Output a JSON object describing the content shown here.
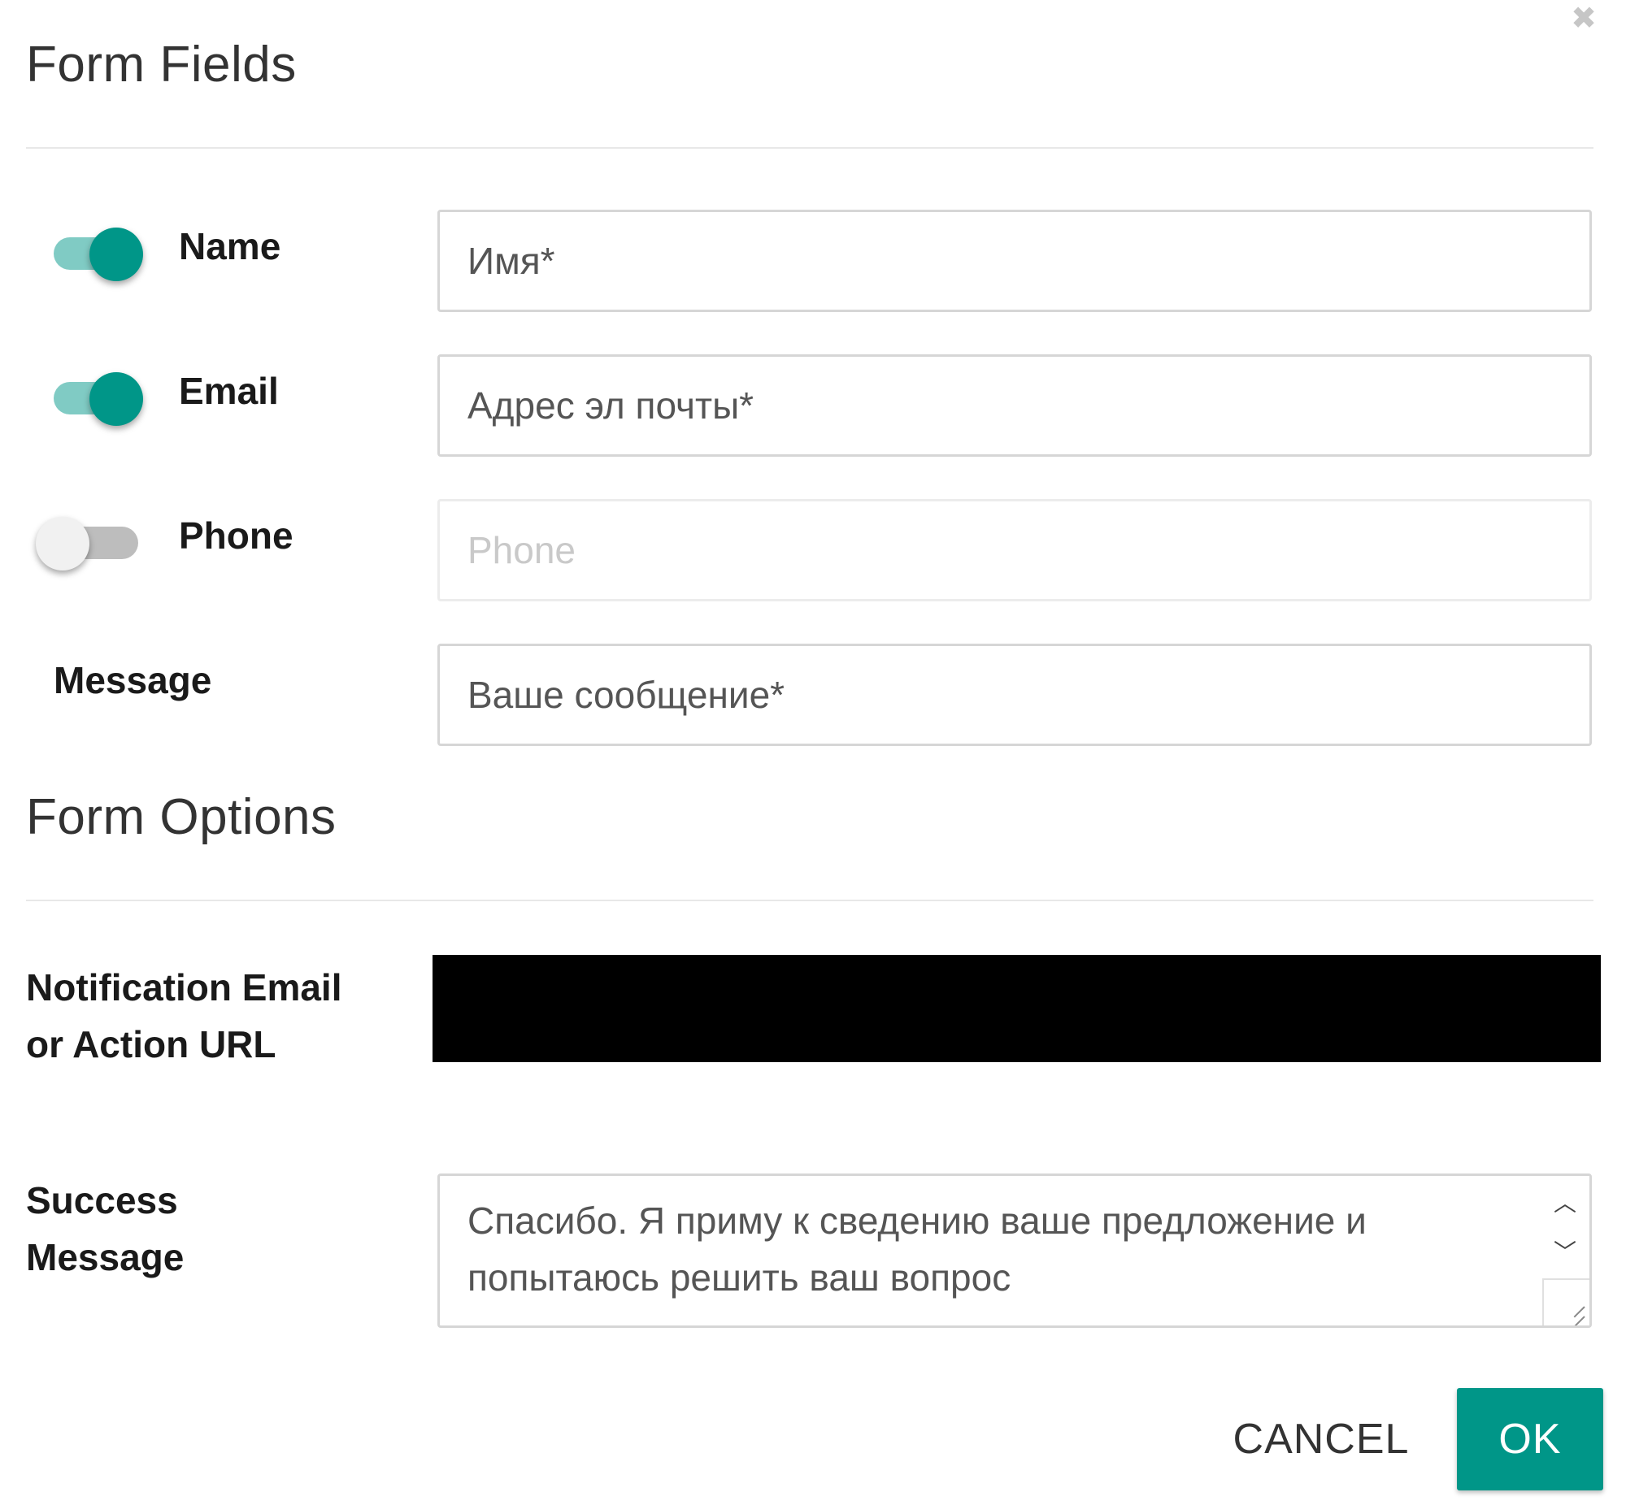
{
  "dialog": {
    "close_icon": "close-icon"
  },
  "sections": {
    "form_fields_title": "Form Fields",
    "form_options_title": "Form Options"
  },
  "fields": {
    "name": {
      "label": "Name",
      "enabled": true,
      "value": "Имя*"
    },
    "email": {
      "label": "Email",
      "enabled": true,
      "value": "Адрес эл почты*"
    },
    "phone": {
      "label": "Phone",
      "enabled": false,
      "placeholder": "Phone"
    },
    "message": {
      "label": "Message",
      "value": "Ваше сообщение*"
    }
  },
  "options": {
    "notification_label": "Notification Email or Action URL",
    "success_label": "Success Message",
    "success_value": "Спасибо. Я приму к сведению ваше предложение и попытаюсь решить ваш вопрос"
  },
  "buttons": {
    "cancel": "CANCEL",
    "ok": "OK"
  },
  "colors": {
    "accent": "#009688",
    "accent_light": "#80cbc4",
    "switch_off_track": "#bdbdbd",
    "switch_off_knob": "#f1f1f1"
  }
}
